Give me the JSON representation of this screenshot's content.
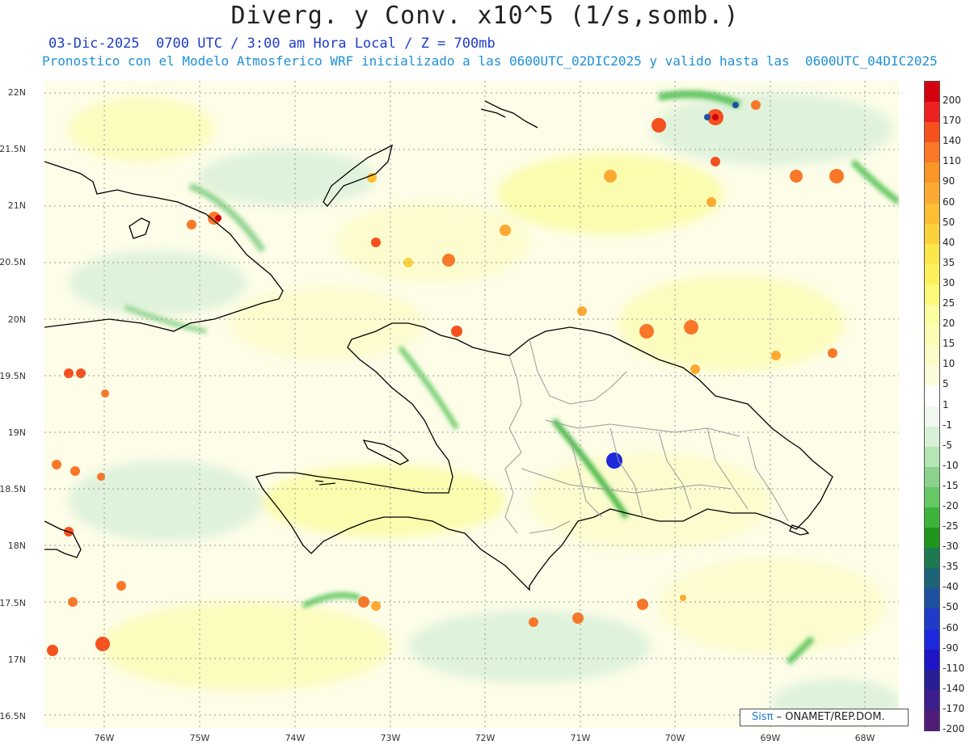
{
  "title": "Diverg. y Conv. x10^5 (1/s,somb.)",
  "subtitle_date": "03-Dic-2025  0700 UTC / 3:00 am Hora Local / Z = 700mb",
  "subtitle_model": "Pronostico con el Modelo Atmosferico WRF inicializado a las 0600UTC_02DIC2025 y valido hasta las  0600UTC_04DIC2025",
  "lat_labels": [
    "22N",
    "21.5N",
    "21N",
    "20.5N",
    "20N",
    "19.5N",
    "19N",
    "18.5N",
    "18N",
    "17.5N",
    "17N",
    "16.5N"
  ],
  "lon_labels": [
    "76W",
    "75W",
    "74W",
    "73W",
    "72W",
    "71W",
    "70W",
    "69W",
    "68W"
  ],
  "legend": {
    "labels": [
      "200",
      "170",
      "140",
      "110",
      "90",
      "60",
      "50",
      "40",
      "35",
      "30",
      "25",
      "20",
      "15",
      "10",
      "5",
      "1",
      "-1",
      "-5",
      "-10",
      "-15",
      "-20",
      "-25",
      "-30",
      "-35",
      "-40",
      "-50",
      "-60",
      "-90",
      "-110",
      "-140",
      "-170",
      "-200"
    ],
    "colors": [
      "#d4000f",
      "#ee2020",
      "#f5501e",
      "#f87828",
      "#fa9628",
      "#fcaa32",
      "#fcbe32",
      "#fcd23c",
      "#fce64b",
      "#fcf05a",
      "#fcf878",
      "#fcfca0",
      "#fcfcb4",
      "#fcfcc8",
      "#fcfcdc",
      "#ffffff",
      "#f0f8f0",
      "#d8f0d8",
      "#b4e6b4",
      "#8cd28c",
      "#64c864",
      "#3cb43c",
      "#1e961e",
      "#1e7850",
      "#1e6478",
      "#1e50a0",
      "#1e3cc8",
      "#1e28dc",
      "#1e14c8",
      "#281e96",
      "#3c1e8c",
      "#501e78"
    ]
  },
  "credit": {
    "logo": "Sisπ",
    "org": "– ONAMET/REP.DOM."
  }
}
